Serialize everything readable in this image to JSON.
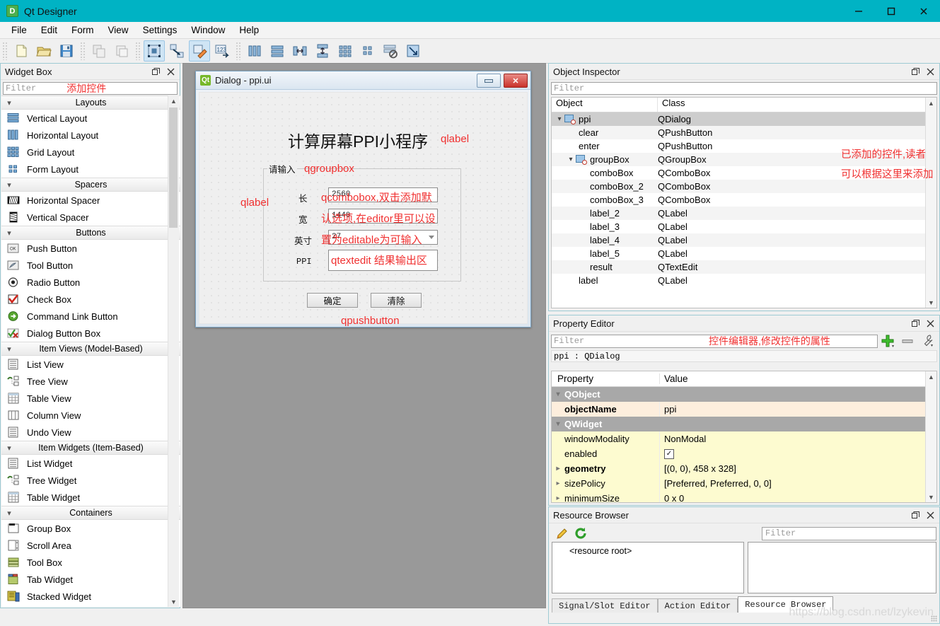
{
  "window": {
    "title": "Qt Designer",
    "app_icon": "D",
    "controls": [
      {
        "name": "minimize-button",
        "glyph": "minimize-icon"
      },
      {
        "name": "maximize-button",
        "glyph": "maximize-icon"
      },
      {
        "name": "close-button",
        "glyph": "close-icon"
      }
    ]
  },
  "menubar": {
    "items": [
      "File",
      "Edit",
      "Form",
      "View",
      "Settings",
      "Window",
      "Help"
    ]
  },
  "toolbar": {
    "groups": [
      [
        "new-file-icon",
        "open-file-icon",
        "save-file-icon"
      ],
      [
        "copy-icon",
        "paste-icon"
      ],
      [
        "edit-widgets-icon",
        "edit-signals-slots-icon",
        "edit-buddies-icon",
        "edit-tab-order-icon"
      ],
      [
        "layout-horizontally-icon",
        "layout-vertically-icon",
        "layout-in-splitter-h-icon",
        "layout-in-splitter-v-icon",
        "layout-grid-icon",
        "layout-form-icon",
        "break-layout-icon",
        "adjust-size-icon"
      ]
    ]
  },
  "widget_box": {
    "title": "Widget Box",
    "filter_placeholder": "Filter",
    "annotation": "添加控件",
    "groups": [
      {
        "label": "Layouts",
        "items": [
          {
            "label": "Vertical Layout",
            "icon": "vertical-layout-icon"
          },
          {
            "label": "Horizontal Layout",
            "icon": "horizontal-layout-icon"
          },
          {
            "label": "Grid Layout",
            "icon": "grid-layout-icon"
          },
          {
            "label": "Form Layout",
            "icon": "form-layout-icon"
          }
        ]
      },
      {
        "label": "Spacers",
        "items": [
          {
            "label": "Horizontal Spacer",
            "icon": "horizontal-spacer-icon"
          },
          {
            "label": "Vertical Spacer",
            "icon": "vertical-spacer-icon"
          }
        ]
      },
      {
        "label": "Buttons",
        "items": [
          {
            "label": "Push Button",
            "icon": "push-button-icon"
          },
          {
            "label": "Tool Button",
            "icon": "tool-button-icon"
          },
          {
            "label": "Radio Button",
            "icon": "radio-button-icon"
          },
          {
            "label": "Check Box",
            "icon": "check-box-icon"
          },
          {
            "label": "Command Link Button",
            "icon": "command-link-button-icon"
          },
          {
            "label": "Dialog Button Box",
            "icon": "dialog-button-box-icon"
          }
        ]
      },
      {
        "label": "Item Views (Model-Based)",
        "items": [
          {
            "label": "List View",
            "icon": "list-view-icon"
          },
          {
            "label": "Tree View",
            "icon": "tree-view-icon"
          },
          {
            "label": "Table View",
            "icon": "table-view-icon"
          },
          {
            "label": "Column View",
            "icon": "column-view-icon"
          },
          {
            "label": "Undo View",
            "icon": "undo-view-icon"
          }
        ]
      },
      {
        "label": "Item Widgets (Item-Based)",
        "items": [
          {
            "label": "List Widget",
            "icon": "list-widget-icon"
          },
          {
            "label": "Tree Widget",
            "icon": "tree-widget-icon"
          },
          {
            "label": "Table Widget",
            "icon": "table-widget-icon"
          }
        ]
      },
      {
        "label": "Containers",
        "items": [
          {
            "label": "Group Box",
            "icon": "group-box-icon"
          },
          {
            "label": "Scroll Area",
            "icon": "scroll-area-icon"
          },
          {
            "label": "Tool Box",
            "icon": "tool-box-icon"
          },
          {
            "label": "Tab Widget",
            "icon": "tab-widget-icon"
          },
          {
            "label": "Stacked Widget",
            "icon": "stacked-widget-icon"
          }
        ]
      }
    ]
  },
  "form": {
    "window_title": "Dialog - ppi.ui",
    "icon_text": "Qt",
    "heading": "计算屏幕PPI小程序",
    "heading_annotation": "qlabel",
    "groupbox_title": "请输入",
    "groupbox_annotation": "qgroupbox",
    "label_annotation": "qlabel",
    "rows": [
      {
        "label": "长",
        "value": "2560",
        "annotation": "qcombobox,双击添加默"
      },
      {
        "label": "宽",
        "value": "1440",
        "annotation": "认选项,在editor里可以设"
      },
      {
        "label": "英寸",
        "value": "27",
        "annotation": "置为editable为可输入"
      }
    ],
    "result_label": "PPI",
    "result_annotation": "qtextedit 结果输出区",
    "buttons": [
      {
        "label": "确定",
        "name": "ok-button"
      },
      {
        "label": "清除",
        "name": "clear-button"
      }
    ],
    "buttons_annotation": "qpushbutton"
  },
  "object_inspector": {
    "title": "Object Inspector",
    "filter_placeholder": "Filter",
    "columns": [
      "Object",
      "Class"
    ],
    "annotations": [
      "已添加的控件,读者",
      "可以根据这里来添加"
    ],
    "rows": [
      {
        "object": "ppi",
        "class": "QDialog",
        "depth": 0,
        "expander": true,
        "icon": true,
        "selected": true
      },
      {
        "object": "clear",
        "class": "QPushButton",
        "depth": 1,
        "expander": false,
        "icon": false,
        "selected": false
      },
      {
        "object": "enter",
        "class": "QPushButton",
        "depth": 1,
        "expander": false,
        "icon": false,
        "selected": false
      },
      {
        "object": "groupBox",
        "class": "QGroupBox",
        "depth": 1,
        "expander": true,
        "icon": true,
        "selected": false
      },
      {
        "object": "comboBox",
        "class": "QComboBox",
        "depth": 2,
        "expander": false,
        "icon": false,
        "selected": false
      },
      {
        "object": "comboBox_2",
        "class": "QComboBox",
        "depth": 2,
        "expander": false,
        "icon": false,
        "selected": false
      },
      {
        "object": "comboBox_3",
        "class": "QComboBox",
        "depth": 2,
        "expander": false,
        "icon": false,
        "selected": false
      },
      {
        "object": "label_2",
        "class": "QLabel",
        "depth": 2,
        "expander": false,
        "icon": false,
        "selected": false
      },
      {
        "object": "label_3",
        "class": "QLabel",
        "depth": 2,
        "expander": false,
        "icon": false,
        "selected": false
      },
      {
        "object": "label_4",
        "class": "QLabel",
        "depth": 2,
        "expander": false,
        "icon": false,
        "selected": false
      },
      {
        "object": "label_5",
        "class": "QLabel",
        "depth": 2,
        "expander": false,
        "icon": false,
        "selected": false
      },
      {
        "object": "result",
        "class": "QTextEdit",
        "depth": 2,
        "expander": false,
        "icon": false,
        "selected": false
      },
      {
        "object": "label",
        "class": "QLabel",
        "depth": 1,
        "expander": false,
        "icon": false,
        "selected": false
      }
    ]
  },
  "property_editor": {
    "title": "Property Editor",
    "filter_placeholder": "Filter",
    "annotation": "控件编辑器,修改控件的属性",
    "object_line": "ppi : QDialog",
    "columns": [
      "Property",
      "Value"
    ],
    "tool_icons": [
      "add-property-icon",
      "remove-property-icon",
      "configure-icon"
    ],
    "rows": [
      {
        "property": "QObject",
        "value": "",
        "style": "group",
        "expander": "down"
      },
      {
        "property": "objectName",
        "value": "ppi",
        "style": "warm",
        "expander": ""
      },
      {
        "property": "QWidget",
        "value": "",
        "style": "group",
        "expander": "down"
      },
      {
        "property": "windowModality",
        "value": "NonModal",
        "style": "yellow",
        "expander": ""
      },
      {
        "property": "enabled",
        "value": "checkbox-checked",
        "style": "yellow",
        "expander": ""
      },
      {
        "property": "geometry",
        "value": "[(0, 0), 458 x 328]",
        "style": "yellow-bold",
        "expander": "right"
      },
      {
        "property": "sizePolicy",
        "value": "[Preferred, Preferred, 0, 0]",
        "style": "yellow",
        "expander": "right"
      },
      {
        "property": "minimumSize",
        "value": "0 x 0",
        "style": "yellow",
        "expander": "right"
      }
    ]
  },
  "resource_browser": {
    "title": "Resource Browser",
    "filter_placeholder": "Filter",
    "tool_icons": [
      "edit-resources-icon",
      "reload-icon"
    ],
    "root_label": "<resource root>",
    "tabs": [
      {
        "label": "Signal/Slot Editor",
        "active": false
      },
      {
        "label": "Action Editor",
        "active": false
      },
      {
        "label": "Resource Browser",
        "active": true
      }
    ],
    "watermark": "https://blog.csdn.net/lzykevin"
  },
  "colors": {
    "titlebar": "#00b3c4",
    "annotation": "#f03030",
    "workspace": "#999999",
    "panel": "#f0f0f0"
  }
}
